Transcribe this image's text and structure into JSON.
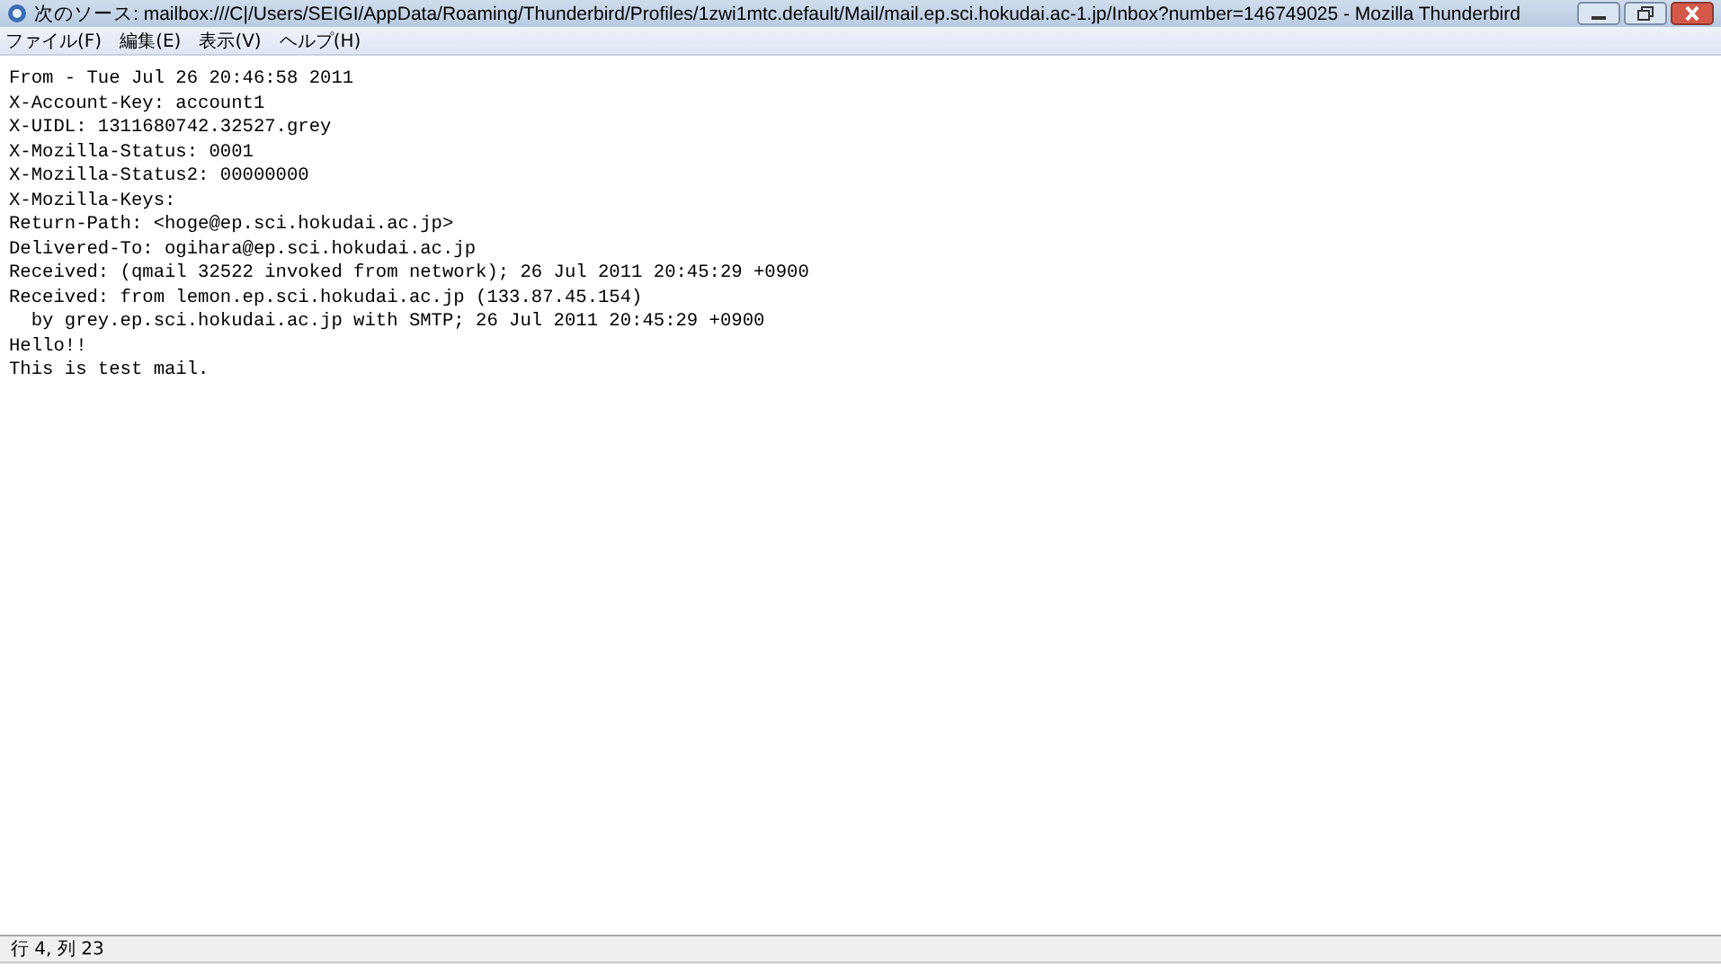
{
  "window": {
    "title": "次のソース: mailbox:///C|/Users/SEIGI/AppData/Roaming/Thunderbird/Profiles/1zwi1mtc.default/Mail/mail.ep.sci.hokudai.ac-1.jp/Inbox?number=146749025 - Mozilla Thunderbird"
  },
  "menu": [
    "ファイル(F)",
    "編集(E)",
    "表示(V)",
    "ヘルプ(H)"
  ],
  "source_lines": [
    "From - Tue Jul 26 20:46:58 2011",
    "X-Account-Key: account1",
    "X-UIDL: 1311680742.32527.grey",
    "X-Mozilla-Status: 0001",
    "X-Mozilla-Status2: 00000000",
    "X-Mozilla-Keys:",
    "Return-Path: <hoge@ep.sci.hokudai.ac.jp>",
    "Delivered-To: ogihara@ep.sci.hokudai.ac.jp",
    "Received: (qmail 32522 invoked from network); 26 Jul 2011 20:45:29 +0900",
    "Received: from lemon.ep.sci.hokudai.ac.jp (133.87.45.154)",
    "  by grey.ep.sci.hokudai.ac.jp with SMTP; 26 Jul 2011 20:45:29 +0900",
    "Hello!!",
    "This is test mail."
  ],
  "status_bar": {
    "position": "行 4, 列 23"
  }
}
